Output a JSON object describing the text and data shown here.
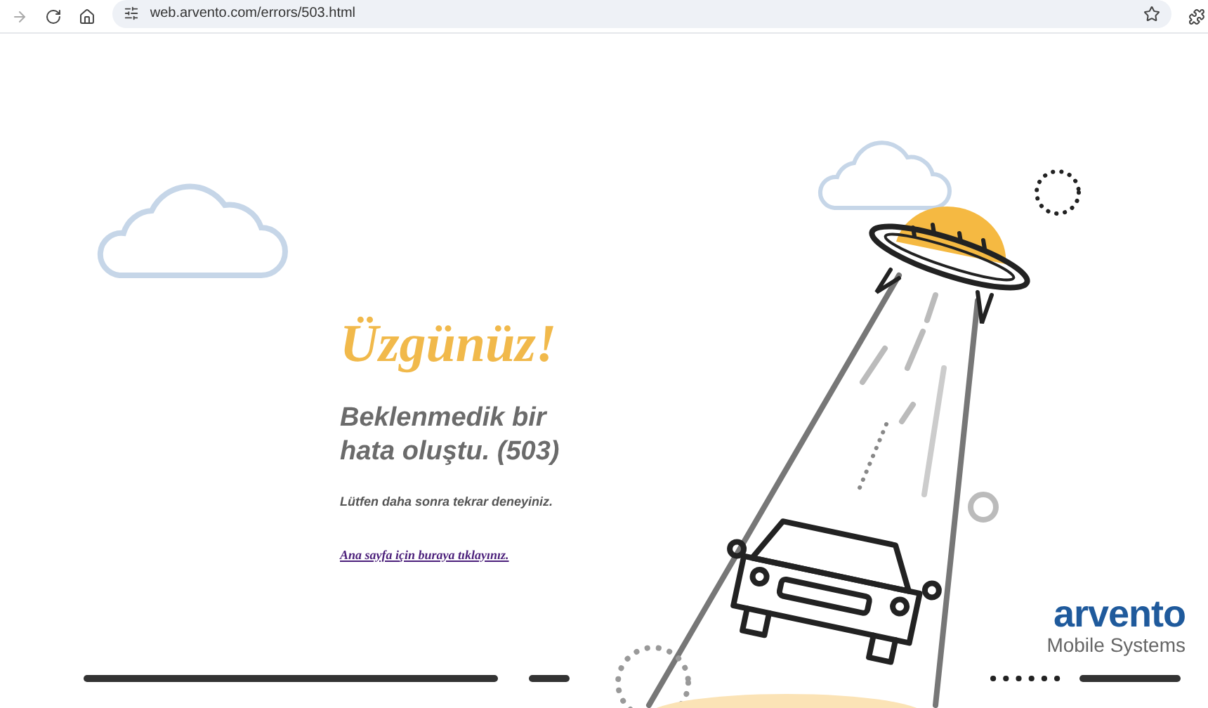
{
  "browser": {
    "url": "web.arvento.com/errors/503.html"
  },
  "error": {
    "title": "Üzgünüz!",
    "message_lines": [
      "Beklenmedik bir",
      "hata oluştu. (503)"
    ],
    "hint": "Lütfen daha sonra tekrar deneyiniz.",
    "link": "Ana sayfa için buraya tıklayınız."
  },
  "logo": {
    "name": "arvento",
    "tagline": "Mobile Systems"
  }
}
